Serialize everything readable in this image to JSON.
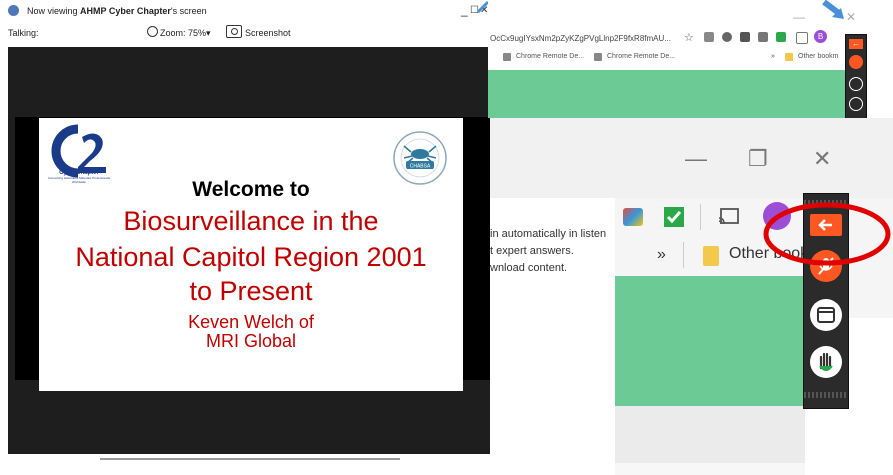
{
  "viewer": {
    "title_prefix": "Now viewing ",
    "title_name": "AHMP Cyber Chapter",
    "title_suffix": "'s screen",
    "talking_label": "Talking:",
    "zoom_label": "Zoom: 75%",
    "zoom_caret": "▾",
    "screenshot_label": "Screenshot",
    "minimize": "_",
    "maximize": "☐",
    "close": "✕"
  },
  "slide": {
    "logo_c2": "C2",
    "logo_ahmp": "AHMP",
    "logo_cyber": "CyberChapter",
    "logo_tagline": "Connecting Hazardous Materials Professionals Worldwide",
    "seal_label": "CHABSA",
    "welcome": "Welcome to",
    "line1": "Biosurveillance in the",
    "line2": "National Capitol Region 2001",
    "line3": "to Present",
    "presenter1": "Keven Welch of",
    "presenter2": "MRI Global"
  },
  "small_browser": {
    "url": "OcCx9ugIYsxNm2pZyKZgPVgLlnp2F9fxR8fmAU...",
    "star": "☆",
    "minimize": "—",
    "close": "✕",
    "profile_initial": "B",
    "bookmarks": [
      {
        "label": "Chrome Remote De..."
      },
      {
        "label": "Chrome Remote De..."
      }
    ],
    "more": "»",
    "other_bookmarks": "Other bookm"
  },
  "big_browser": {
    "minimize": "—",
    "restore": "❐",
    "close": "✕",
    "text_lines": [
      "in automatically in listen",
      "t expert answers.",
      "wnload content."
    ],
    "more": "»",
    "other_bookmarks": "Other bookm"
  },
  "colors": {
    "accent_red": "#c00000",
    "panel_orange": "#ff5722",
    "green_band": "#6ccb94",
    "highlight_circle": "#e00000"
  }
}
